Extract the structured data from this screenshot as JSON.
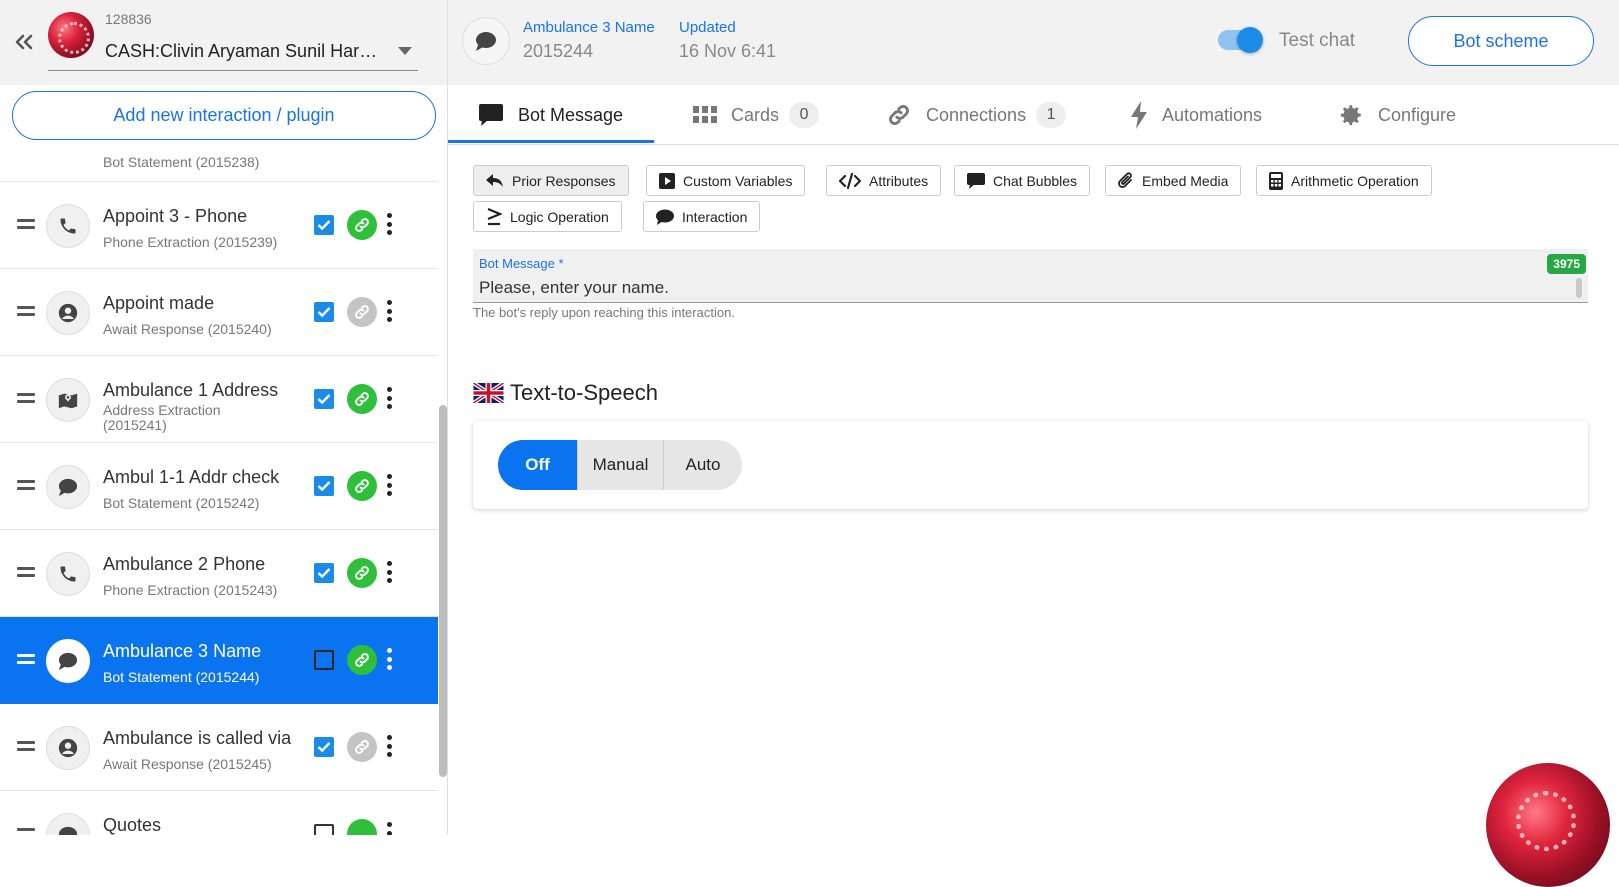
{
  "sidebar": {
    "bot_id": "128836",
    "bot_name": "CASH:Clivin Aryaman Sunil Harsha",
    "add_button": "Add new interaction / plugin",
    "partial_top_sub": "Bot Statement (2015238)",
    "items": [
      {
        "title": "Appoint 3 - Phone",
        "sub": "Phone Extraction (2015239)",
        "icon": "phone-icon",
        "checked": true,
        "linked": true
      },
      {
        "title": "Appoint made",
        "sub": "Await Response (2015240)",
        "icon": "user-circle-icon",
        "checked": true,
        "linked": false
      },
      {
        "title": "Ambulance 1 Address",
        "sub": "Address Extraction (2015241)",
        "icon": "map-icon",
        "checked": true,
        "linked": true
      },
      {
        "title": "Ambul 1-1 Addr check",
        "sub": "Bot Statement (2015242)",
        "icon": "chat-bubble-icon",
        "checked": true,
        "linked": true
      },
      {
        "title": "Ambulance 2 Phone",
        "sub": "Phone Extraction (2015243)",
        "icon": "phone-icon",
        "checked": true,
        "linked": true
      },
      {
        "title": "Ambulance 3 Name",
        "sub": "Bot Statement (2015244)",
        "icon": "chat-bubble-icon",
        "checked": false,
        "linked": true,
        "selected": true
      },
      {
        "title": "Ambulance is called via",
        "sub": "Await Response (2015245)",
        "icon": "user-circle-icon",
        "checked": true,
        "linked": false
      },
      {
        "title": "Quotes",
        "sub": "",
        "icon": "chat-bubble-icon",
        "checked": false,
        "linked": true
      }
    ]
  },
  "header": {
    "name_label": "Ambulance 3 Name",
    "name_value": "2015244",
    "updated_label": "Updated",
    "updated_value": "16 Nov 6:41",
    "test_chat": "Test chat",
    "bot_scheme": "Bot scheme"
  },
  "tabs": [
    {
      "label": "Bot Message",
      "icon": "chat-bubble-icon",
      "active": true
    },
    {
      "label": "Cards",
      "icon": "grid-icon",
      "badge": "0"
    },
    {
      "label": "Connections",
      "icon": "link-icon",
      "badge": "1"
    },
    {
      "label": "Automations",
      "icon": "bolt-icon"
    },
    {
      "label": "Configure",
      "icon": "gear-icon"
    }
  ],
  "toolbar": {
    "prior_responses": "Prior Responses",
    "custom_variables": "Custom Variables",
    "attributes": "Attributes",
    "chat_bubbles": "Chat Bubbles",
    "embed_media": "Embed Media",
    "arithmetic_operation": "Arithmetic Operation",
    "logic_operation": "Logic Operation",
    "interaction": "Interaction"
  },
  "bot_message": {
    "label": "Bot Message *",
    "value": "Please, enter your name.",
    "counter": "3975",
    "hint": "The bot's reply upon reaching this interaction."
  },
  "tts": {
    "title": "Text-to-Speech",
    "options": [
      "Off",
      "Manual",
      "Auto"
    ],
    "selected": "Off"
  },
  "colors": {
    "accent": "#1a73e8",
    "selected_row": "#0a73f0",
    "link_green": "#2fbf3b",
    "counter_green": "#28a745"
  }
}
